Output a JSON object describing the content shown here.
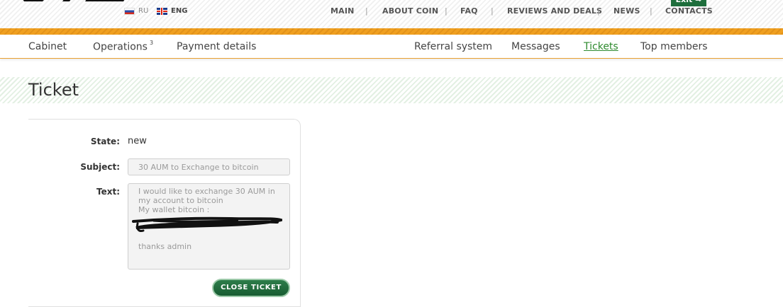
{
  "header": {
    "languages": [
      {
        "code": "RU",
        "flag": "ru-flag-icon"
      },
      {
        "code": "ENG",
        "flag": "uk-flag-icon"
      }
    ],
    "nav": [
      "MAIN",
      "ABOUT COIN",
      "FAQ",
      "REVIEWS AND DEALS",
      "NEWS",
      "CONTACTS"
    ],
    "separator": "|",
    "exit_label": "Exit ⇒"
  },
  "cabinet_nav": {
    "left": [
      {
        "label": "Cabinet"
      },
      {
        "label": "Operations",
        "badge": "3"
      },
      {
        "label": "Payment details"
      }
    ],
    "right": [
      {
        "label": "Referral system"
      },
      {
        "label": "Messages"
      },
      {
        "label": "Tickets",
        "active": true
      },
      {
        "label": "Top members"
      }
    ]
  },
  "page": {
    "title": "Ticket"
  },
  "ticket": {
    "state_label": "State:",
    "state_value": "new",
    "subject_label": "Subject:",
    "subject_value": "30 AUM to Exchange to bitcoin",
    "text_label": "Text:",
    "text_value": "I would like to exchange 30 AUM in my account to bitcoin\nMy wallet bitcoin :\n\n\n\nthanks admin",
    "close_button": "CLOSE TICKET"
  },
  "colors": {
    "accent_orange": "#f0a020",
    "accent_green": "#1e6e3c",
    "active_tab": "#2e8a2e"
  }
}
